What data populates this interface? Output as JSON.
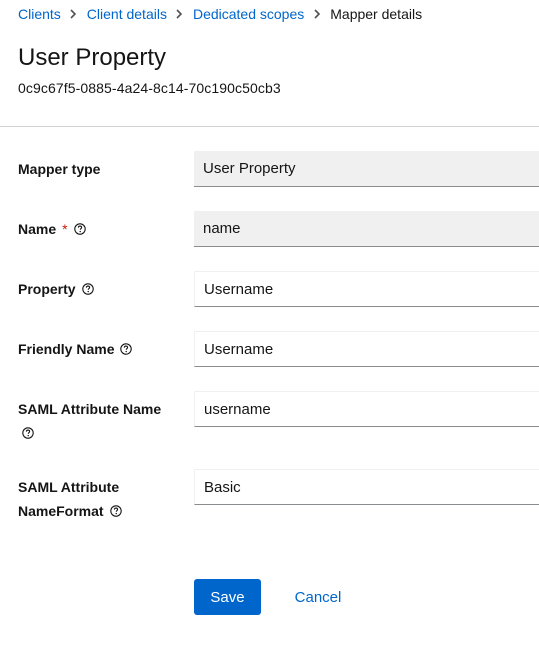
{
  "breadcrumb": {
    "items": [
      {
        "label": "Clients"
      },
      {
        "label": "Client details"
      },
      {
        "label": "Dedicated scopes"
      }
    ],
    "current": "Mapper details"
  },
  "header": {
    "title": "User Property",
    "subtitle": "0c9c67f5-0885-4a24-8c14-70c190c50cb3"
  },
  "form": {
    "mapper_type": {
      "label": "Mapper type",
      "value": "User Property"
    },
    "name": {
      "label": "Name",
      "required_marker": "*",
      "value": "name"
    },
    "property": {
      "label": "Property",
      "value": "Username"
    },
    "friendly_name": {
      "label": "Friendly Name",
      "value": "Username"
    },
    "saml_attribute_name": {
      "label_line1": "SAML Attribute Name",
      "value": "username"
    },
    "saml_attribute_nameformat": {
      "label_line1": "SAML Attribute",
      "label_line2": "NameFormat",
      "value": "Basic"
    }
  },
  "actions": {
    "save_label": "Save",
    "cancel_label": "Cancel"
  },
  "colors": {
    "link": "#0066cc",
    "primary_button": "#0066cc",
    "required": "#c9190b",
    "readonly_field_bg": "#f0f0f0"
  },
  "icons": {
    "separator": "chevron-right-icon",
    "help": "help-circle-icon"
  }
}
